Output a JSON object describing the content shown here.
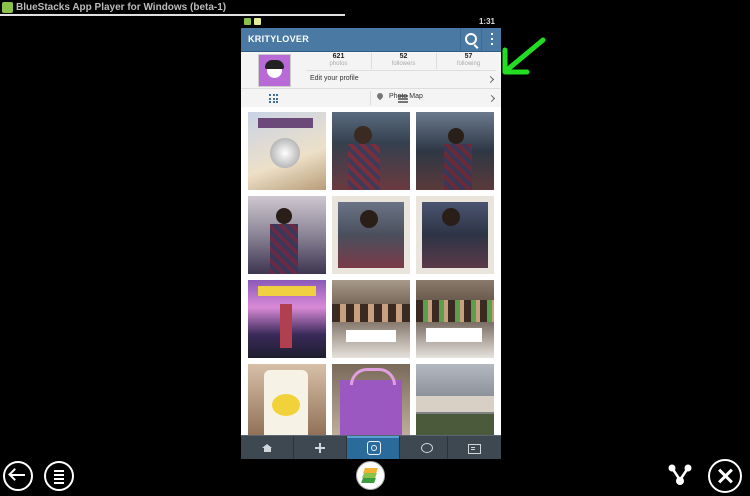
{
  "window": {
    "title": "BlueStacks App Player for Windows (beta-1)"
  },
  "statusbar": {
    "time": "1:31"
  },
  "app": {
    "username": "KRITYLOVER",
    "stats": [
      {
        "value": "621",
        "label": "photos"
      },
      {
        "value": "52",
        "label": "followers"
      },
      {
        "value": "57",
        "label": "following"
      }
    ],
    "edit_profile_label": "Edit your profile",
    "photo_map_label": "Photo Map"
  },
  "colors": {
    "appbar": "#4a7aa3",
    "tab_active": "#2b6b9c",
    "annotation_arrow": "#22dd22"
  },
  "icons": [
    "search-icon",
    "overflow-menu-icon",
    "grid-view-icon",
    "list-view-icon",
    "map-pin-icon",
    "home-icon",
    "explore-icon",
    "camera-icon",
    "news-icon",
    "profile-icon",
    "back-icon",
    "menu-icon",
    "bluestacks-logo",
    "share-icon",
    "settings-icon"
  ]
}
